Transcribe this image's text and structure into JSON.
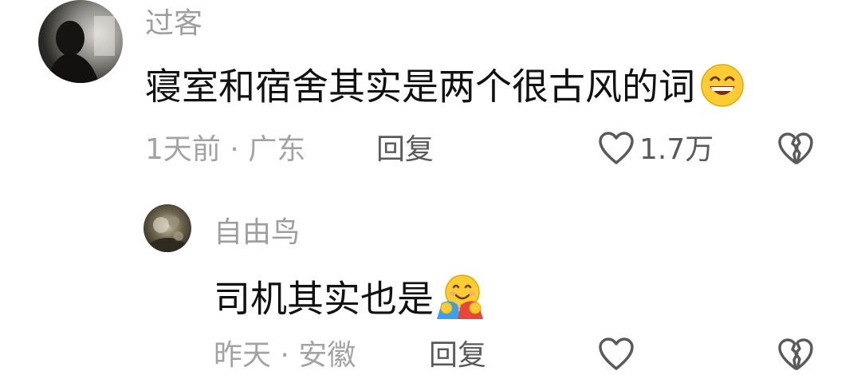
{
  "comments": [
    {
      "username": "过客",
      "text": "寝室和宿舍其实是两个很古风的词",
      "emoji": "grinning-face-with-smiling-eyes",
      "time": "1天前",
      "location": "广东",
      "separator": "·",
      "reply_label": "回复",
      "like_count": "1.7万"
    },
    {
      "username": "自由鸟",
      "text": "司机其实也是",
      "emoji": "hugging-face",
      "time": "昨天",
      "location": "安徽",
      "separator": "·",
      "reply_label": "回复",
      "like_count": ""
    }
  ],
  "colors": {
    "username": "#9e9e9e",
    "text": "#111111",
    "meta": "#a3a3a3",
    "action": "#5a5a5a"
  }
}
